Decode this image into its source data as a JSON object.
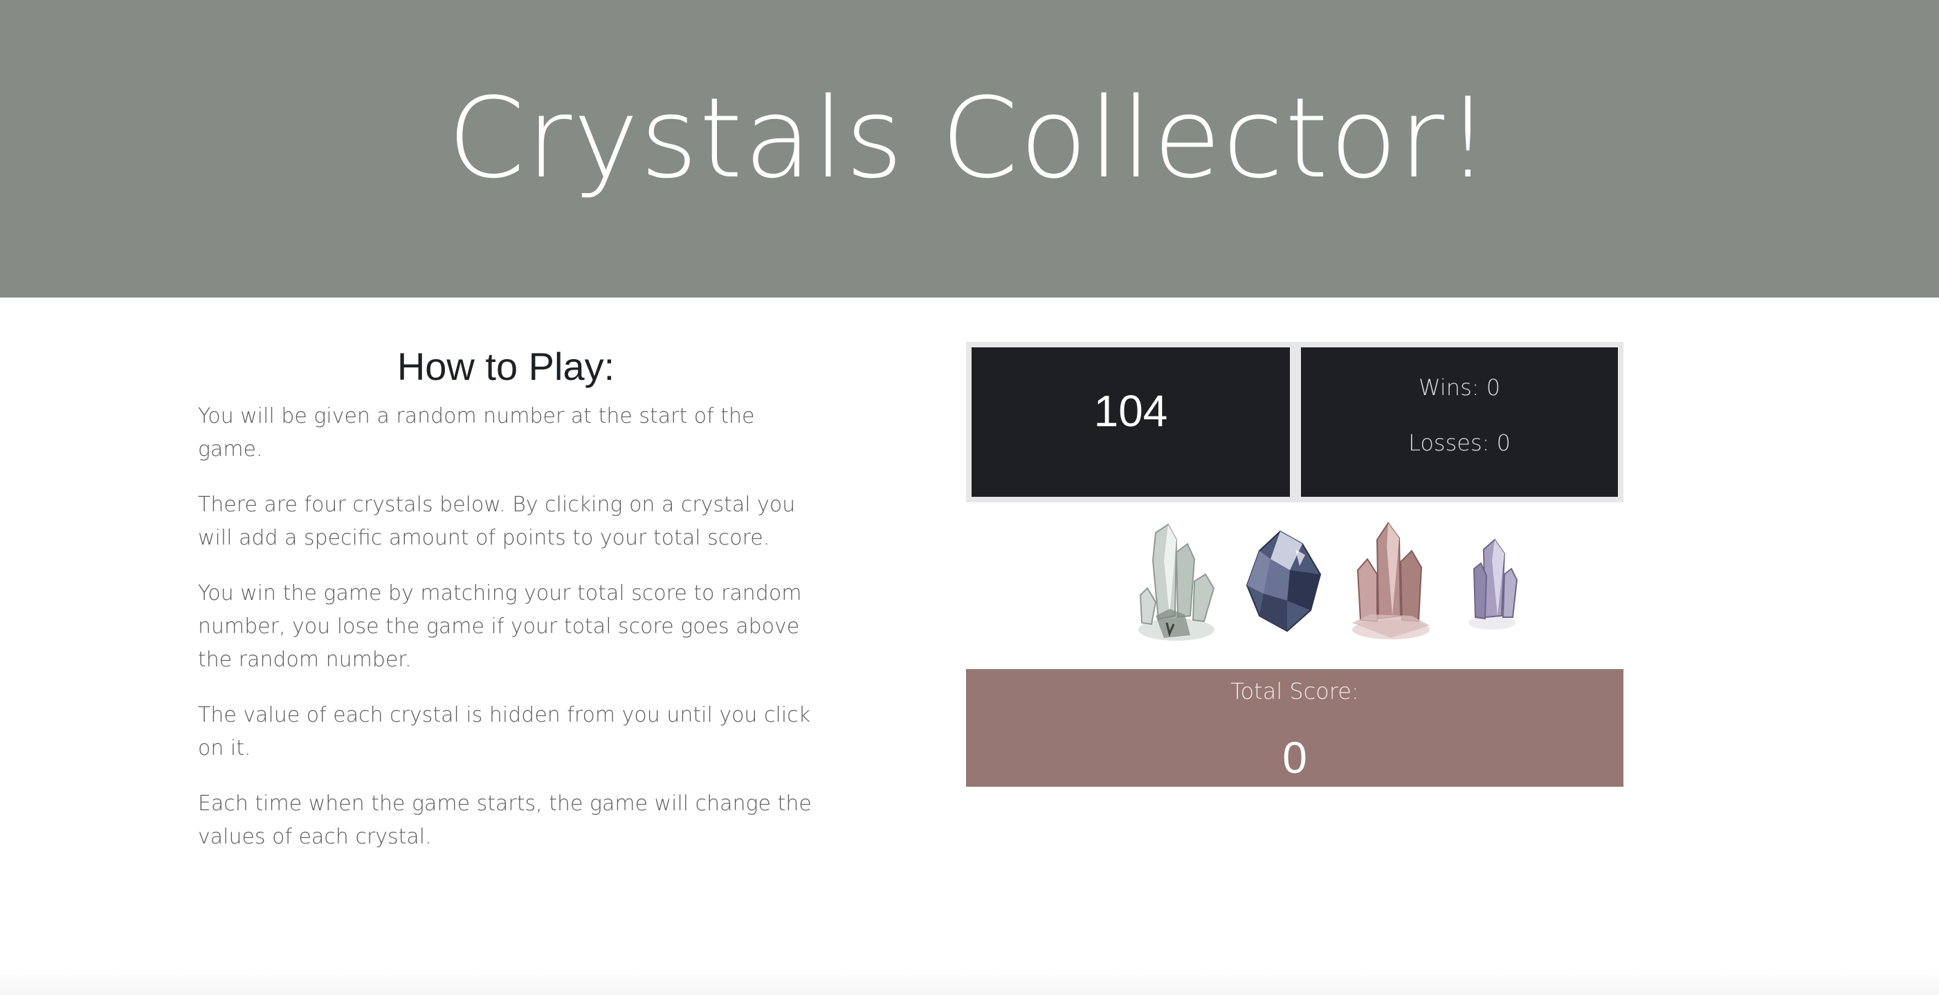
{
  "header": {
    "title": "Crystals Collector!",
    "background_color": "#858c85"
  },
  "how_to_play": {
    "title": "How to Play:",
    "paragraphs": [
      "You will be given a random number at the start of the game.",
      "There are four crystals below. By clicking on a crystal you will add a specific amount of points to your total score.",
      "You win the game by matching your total score to random number, you lose the game if your total score goes above the random number.",
      "The value of each crystal is hidden from you until you click on it.",
      "Each time when the game starts, the game will change the values of each crystal."
    ]
  },
  "scoreboard": {
    "target_number": "104",
    "wins_label": "Wins: 0",
    "losses_label": "Losses: 0",
    "panel_color": "#1d1f23"
  },
  "crystals": [
    {
      "name": "clear-quartz-crystal-icon"
    },
    {
      "name": "blue-crystal-icon"
    },
    {
      "name": "pink-crystal-icon"
    },
    {
      "name": "amethyst-crystal-icon"
    }
  ],
  "total_score": {
    "label": "Total Score:",
    "value": "0",
    "background_color": "#967774"
  }
}
